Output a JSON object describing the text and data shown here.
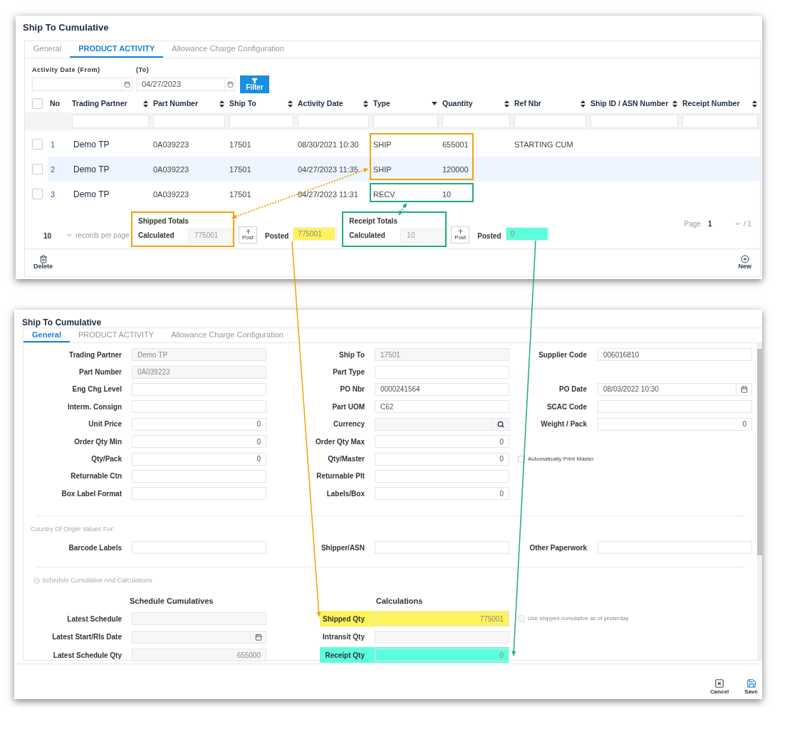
{
  "top": {
    "title": "Ship To Cumulative",
    "tabs": [
      {
        "label": "General",
        "selected": false
      },
      {
        "label": "PRODUCT ACTIVITY",
        "selected": true
      },
      {
        "label": "Allowance Charge Configuration",
        "selected": false
      }
    ],
    "date_from": {
      "label": "Activity Date (From)"
    },
    "date_to": {
      "label": "(To)",
      "value": "04/27/2023"
    },
    "filter_button": "Filter",
    "table": {
      "select_all": {
        "checked": false
      },
      "columns": [
        {
          "label": "No",
          "kind": "plain"
        },
        {
          "label": "Trading Partner",
          "kind": "sortable"
        },
        {
          "label": "Part Number",
          "kind": "sortable"
        },
        {
          "label": "Ship To",
          "kind": "sortable"
        },
        {
          "label": "Activity Date",
          "kind": "sortable"
        },
        {
          "label": "Type",
          "kind": "dropdown"
        },
        {
          "label": "Quantity",
          "kind": "sortable"
        },
        {
          "label": "Ref Nbr",
          "kind": "sortable"
        },
        {
          "label": "Ship ID / ASN Number",
          "kind": "sortable"
        },
        {
          "label": "Receipt Number",
          "kind": "sortable"
        }
      ],
      "rows": [
        {
          "checked": false,
          "selected": false,
          "callout": {
            "color": "#f0a30a"
          },
          "cells": [
            "1",
            "Demo TP",
            "0A039223",
            "17501",
            "08/30/2021 10:30",
            "SHIP",
            "655001",
            "STARTING CUM"
          ]
        },
        {
          "checked": false,
          "selected": true,
          "callout": {
            "color": "#f0a30a"
          },
          "cells": [
            "2",
            "Demo TP",
            "0A039223",
            "17501",
            "04/27/2023 11:35",
            "SHIP",
            "120000"
          ]
        },
        {
          "checked": false,
          "selected": false,
          "callout": {
            "color": "#1fa98a"
          },
          "cells": [
            "3",
            "Demo TP",
            "0A039223",
            "17501",
            "04/27/2023 11:31",
            "RECV",
            "10"
          ]
        }
      ]
    },
    "pager": {
      "page_size": "10",
      "page_size_label": "records per page",
      "page_label": "Page",
      "page": "1",
      "page_total": "/ 1"
    },
    "totals": [
      {
        "title": "Shipped Totals",
        "calculated_label": "Calculated",
        "calculated": "775001",
        "post_button": "Post",
        "posted_label": "Posted",
        "posted": {
          "value": "775001",
          "color": "#fff35c"
        },
        "color": "#f0a30a"
      },
      {
        "title": "Receipt Totals",
        "calculated_label": "Calculated",
        "calculated": "10",
        "post_button": "Post",
        "posted_label": "Posted",
        "posted": {
          "value": "0",
          "color": "#5cfedb"
        },
        "color": "#1fa98a"
      }
    ],
    "toolbar": [
      {
        "label": "Delete",
        "kind": "delete"
      },
      {
        "label": "New",
        "kind": "new"
      }
    ]
  },
  "bottom": {
    "title": "Ship To Cumulative",
    "tabs": [
      {
        "label": "General",
        "selected": true
      },
      {
        "label": "PRODUCT ACTIVITY",
        "selected": false
      },
      {
        "label": "Allowance Charge Configuration",
        "selected": false
      }
    ],
    "rows": [
      {
        "left": {
          "label": "Trading Partner",
          "value": "Demo TP",
          "kind": "readonly"
        },
        "middle": {
          "label": "Ship To",
          "value": "17501",
          "kind": "readonly"
        },
        "right": {
          "label": "Supplier Code",
          "value": "006016810",
          "kind": "text"
        }
      },
      {
        "left": {
          "label": "Part Number",
          "value": "0A039223",
          "kind": "readonly"
        },
        "middle": {
          "label": "Part Type",
          "kind": "text"
        }
      },
      {
        "left": {
          "label": "Eng Chg Level",
          "kind": "text"
        },
        "middle": {
          "label": "PO Nbr",
          "value": "0000241564",
          "kind": "text"
        },
        "right": {
          "label": "PO Date",
          "value": "08/03/2022 10:30",
          "kind": "date"
        }
      },
      {
        "left": {
          "label": "Interm. Consign",
          "kind": "text"
        },
        "middle": {
          "label": "Part UOM",
          "value": "C62",
          "kind": "text"
        },
        "right": {
          "label": "SCAC Code",
          "kind": "text"
        }
      },
      {
        "left": {
          "label": "Unit Price",
          "value": "0",
          "kind": "number"
        },
        "middle": {
          "label": "Currency",
          "kind": "lookup"
        },
        "right": {
          "label": "Weight / Pack",
          "value": "0",
          "kind": "number"
        }
      },
      {
        "left": {
          "label": "Order Qty Min",
          "value": "0",
          "kind": "number"
        },
        "middle": {
          "label": "Order Qty Max",
          "value": "0",
          "kind": "number"
        }
      },
      {
        "left": {
          "label": "Qty/Pack",
          "value": "0",
          "kind": "number"
        },
        "middle": {
          "label": "Qty/Master",
          "value": "0",
          "kind": "number"
        },
        "right": {
          "label": "Automatically Print Master",
          "kind": "checkbox",
          "checked": false,
          "disabled": false
        }
      },
      {
        "left": {
          "label": "Returnable Ctn",
          "kind": "text"
        },
        "middle": {
          "label": "Returnable Plt",
          "kind": "text"
        }
      },
      {
        "left": {
          "label": "Box Label Format",
          "kind": "text"
        },
        "middle": {
          "label": "Labels/Box",
          "value": "0",
          "kind": "number"
        }
      }
    ],
    "origin": {
      "title": "Country Of Origin Values For:",
      "row": {
        "left": {
          "label": "Barcode Labels",
          "kind": "text"
        },
        "middle": {
          "label": "Shipper/ASN",
          "kind": "text"
        },
        "right": {
          "label": "Other Paperwork",
          "kind": "text"
        }
      }
    },
    "schedule": {
      "title": "Schedule Cumulative And Calculations",
      "expanded": true,
      "headers": [
        "Schedule Cumulatives",
        "Calculations"
      ],
      "rows": [
        {
          "left": {
            "label": "Latest Schedule",
            "kind": "readonly"
          },
          "middle": {
            "label": "Shipped Qty",
            "value": "775001",
            "kind": "readonly-number",
            "color": "#fff35c"
          },
          "right": {
            "label": "Use shipped cumulative as of yesterday",
            "kind": "checkbox",
            "checked": false,
            "disabled": true
          }
        },
        {
          "left": {
            "label": "Latest Start/Rls Date",
            "kind": "readonly-date"
          },
          "middle": {
            "label": "Intransit Qty",
            "kind": "readonly"
          }
        },
        {
          "left": {
            "label": "Latest Schedule Qty",
            "value": "655000",
            "kind": "readonly-number"
          },
          "middle": {
            "label": "Receipt Qty",
            "value": "0",
            "kind": "readonly-number",
            "color": "#5cfedb"
          }
        }
      ]
    },
    "buttons": [
      {
        "label": "Cancel",
        "kind": "cancel"
      },
      {
        "label": "Save",
        "kind": "save"
      }
    ]
  }
}
